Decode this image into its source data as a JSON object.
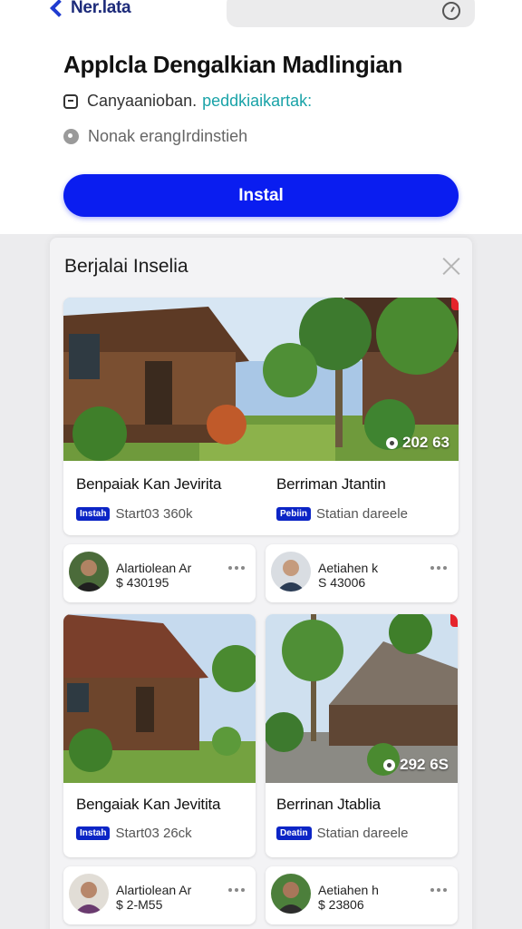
{
  "header": {
    "back_label": "Ner.lata",
    "app_title": "Applcla Dengalkian Madlingian",
    "meta_line1_text": "Canyaanioban.",
    "meta_line1_link": "peddkiaikartak:",
    "meta_line2_text": "Nonak erangIrdinstieh",
    "install_label": "Instal"
  },
  "sheet": {
    "title": "Berjalai Inselia",
    "featured": {
      "count": "202 63",
      "left_title": "Benpaiak Kan Jevirita",
      "left_tag": "Instah",
      "left_sub": "Start03 360k",
      "right_title": "Berriman Jtantin",
      "right_tag": "Pebiin",
      "right_sub": "Statian dareele"
    },
    "users_row1": [
      {
        "name": "Alartiolean Ar",
        "price": "$ 430195"
      },
      {
        "name": "Aetiahen k",
        "price": "S 43006"
      }
    ],
    "cards_row2": [
      {
        "title": "Bengaiak Kan Jevitita",
        "tag": "Instah",
        "sub": "Start03 26ck"
      },
      {
        "title": "Berrinan Jtablia",
        "tag": "Deatin",
        "sub": "Statian dareele",
        "count": "292 6S"
      }
    ],
    "users_row2": [
      {
        "name": "Alartiolean Ar",
        "price": "$ 2-M55"
      },
      {
        "name": "Aetiahen h",
        "price": "$ 23806"
      }
    ]
  },
  "colors": {
    "accent": "#0a1df0",
    "tag": "#0c25c6",
    "link": "#1aa3a8",
    "badge_red": "#e5232b"
  },
  "icons": [
    "chevron-left-icon",
    "clock-icon",
    "chat-icon",
    "info-icon",
    "close-icon",
    "heart-icon",
    "more-icon"
  ]
}
